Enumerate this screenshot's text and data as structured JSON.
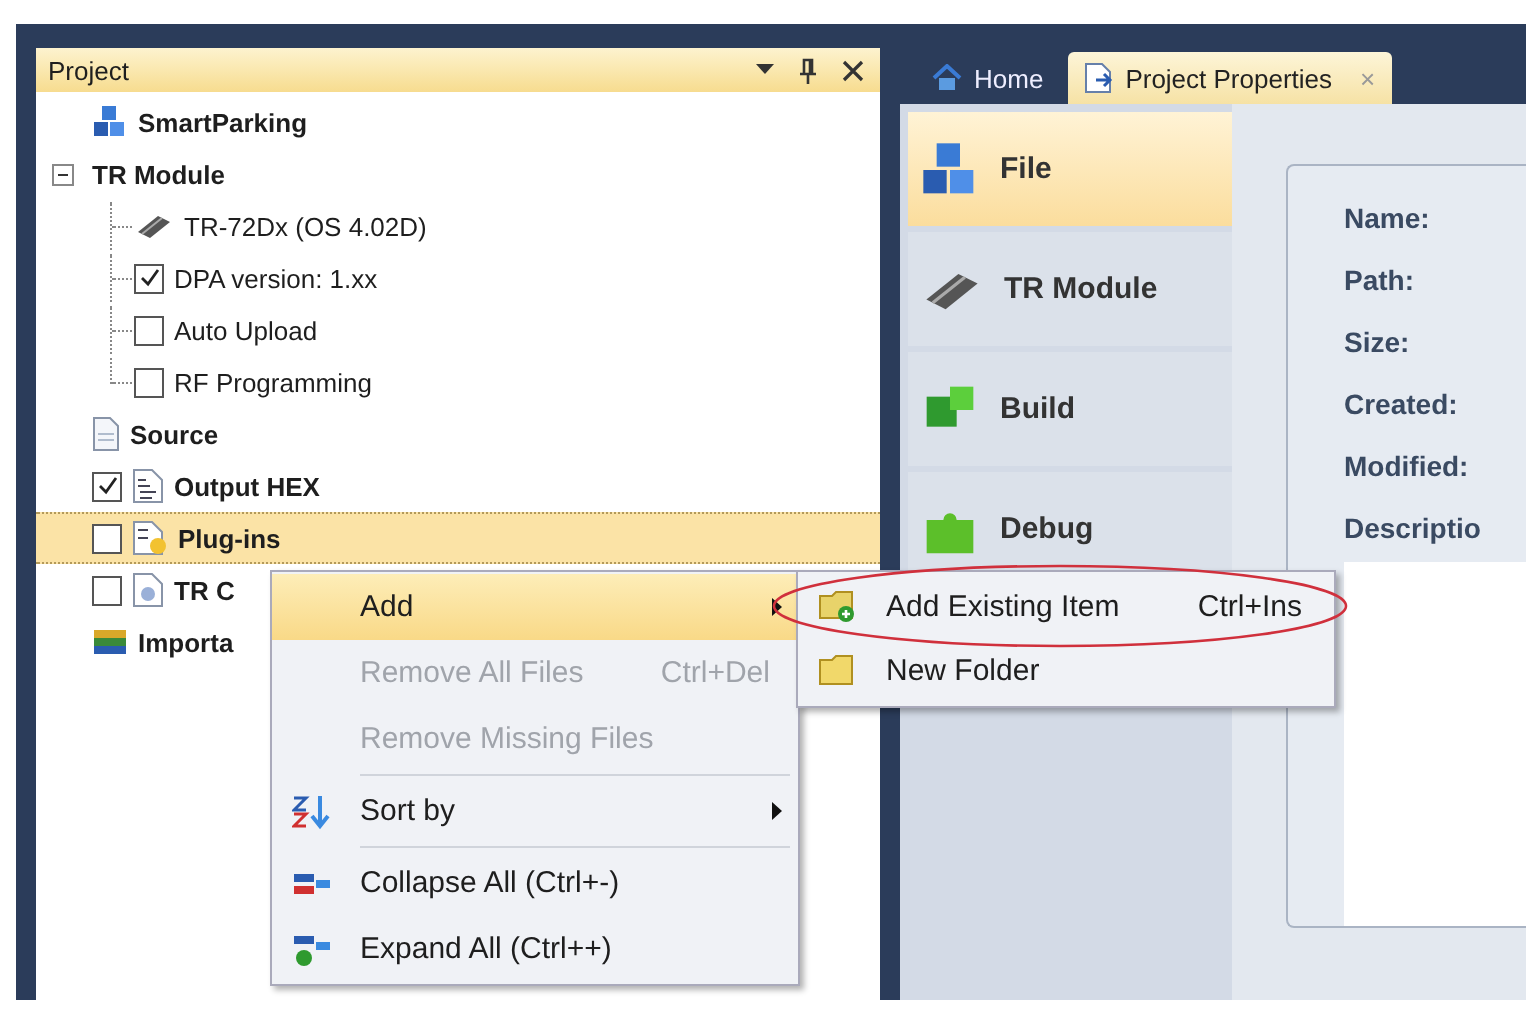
{
  "project_panel": {
    "title": "Project",
    "tree": [
      {
        "label": "SmartParking",
        "kind": "cubes",
        "selected": false
      },
      {
        "label": "TR Module",
        "kind": "none",
        "expanded": true,
        "selected": false,
        "children": [
          {
            "label": "TR-72Dx (OS 4.02D)",
            "kind": "chip",
            "selected": false
          },
          {
            "label": "DPA version: 1.xx",
            "kind": "none",
            "checked": true,
            "selected": false
          },
          {
            "label": "Auto Upload",
            "kind": "none",
            "checked": false,
            "selected": false
          },
          {
            "label": "RF Programming",
            "kind": "none",
            "checked": false,
            "selected": false
          }
        ]
      },
      {
        "label": "Source",
        "kind": "page",
        "selected": false
      },
      {
        "label": "Output HEX",
        "kind": "hex",
        "checked": true,
        "selected": false
      },
      {
        "label": "Plug-ins",
        "kind": "plugin",
        "checked": false,
        "selected": true
      },
      {
        "label": "TR C",
        "kind": "doc",
        "checked": false,
        "selected": false
      },
      {
        "label": "Importa",
        "kind": "books",
        "selected": false
      }
    ]
  },
  "tabs": [
    {
      "label": "Home",
      "kind": "home",
      "selected": false
    },
    {
      "label": "Project Properties",
      "kind": "props",
      "selected": true,
      "close": "×"
    }
  ],
  "nav": [
    {
      "label": "File",
      "kind": "cubes",
      "selected": true
    },
    {
      "label": "TR Module",
      "kind": "chip",
      "selected": false
    },
    {
      "label": "Build",
      "kind": "build",
      "selected": false
    },
    {
      "label": "Debug",
      "kind": "puzzle",
      "selected": false
    }
  ],
  "properties": [
    "Name:",
    "Path:",
    "Size:",
    "Created:",
    "Modified:",
    "Descriptio"
  ],
  "context_menu": [
    {
      "kind": "plain",
      "label": "Add",
      "submenu": true,
      "disabled": false,
      "selected": true
    },
    {
      "kind": "plain",
      "label": "Remove All Files",
      "shortcut": "Ctrl+Del",
      "submenu": false,
      "disabled": true,
      "selected": false
    },
    {
      "kind": "plain",
      "label": "Remove Missing Files",
      "submenu": false,
      "disabled": true,
      "selected": false
    },
    {
      "kind": "separator"
    },
    {
      "kind": "sort",
      "label": "Sort by",
      "submenu": true,
      "disabled": false,
      "selected": false
    },
    {
      "kind": "separator"
    },
    {
      "kind": "collapse",
      "label": "Collapse All (Ctrl+-)",
      "submenu": false,
      "disabled": false,
      "selected": false
    },
    {
      "kind": "expand",
      "label": "Expand All (Ctrl++)",
      "submenu": false,
      "disabled": false,
      "selected": false
    }
  ],
  "submenu": [
    {
      "kind": "add-item",
      "label": "Add Existing Item",
      "shortcut": "Ctrl+Ins",
      "circled": true
    },
    {
      "kind": "folder",
      "label": "New Folder",
      "circled": false
    }
  ]
}
